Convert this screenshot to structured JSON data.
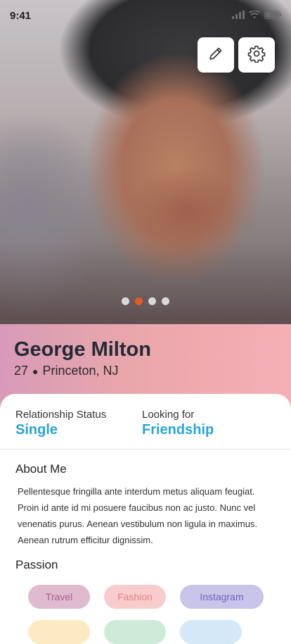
{
  "status": {
    "time": "9:41"
  },
  "profile": {
    "name": "George Milton",
    "age": "27",
    "location": "Princeton, NJ",
    "photos": {
      "count": 4,
      "active_index": 1
    }
  },
  "info": {
    "relationship_label": "Relationship Status",
    "relationship_value": "Single",
    "looking_label": "Looking for",
    "looking_value": "Friendship"
  },
  "about": {
    "title": "About Me",
    "text": "Pellentesque fringilla ante interdum metus aliquam feugiat. Proin id ante id mi posuere faucibus non ac justo. Nunc vel venenatis purus. Aenean vestibulum non ligula in maximus. Aenean rutrum efficitur dignissim."
  },
  "passion": {
    "title": "Passion",
    "chips": [
      "Travel",
      "Fashion",
      "Instagram"
    ]
  },
  "colors": {
    "accent": "#2aa4d6",
    "dot_active": "#e55a25"
  },
  "icons": {
    "edit": "pencil-icon",
    "settings": "gear-icon"
  }
}
